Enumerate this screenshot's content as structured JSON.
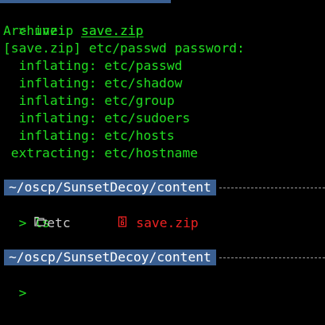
{
  "terminal": {
    "prompt_symbol": ">",
    "unzip_cmd": "unzip",
    "unzip_arg": "save.zip",
    "archive_label": "Archive:  save.zip",
    "password_prompt": "[save.zip] etc/passwd password:",
    "output_lines": [
      "  inflating: etc/passwd",
      "  inflating: etc/shadow",
      "  inflating: etc/group",
      "  inflating: etc/sudoers",
      "  inflating: etc/hosts",
      " extracting: etc/hostname"
    ],
    "cwd": "~/oscp/SunsetDecoy/content",
    "ls_cmd": "ls",
    "ls_items": [
      {
        "name": "etc",
        "icon": "folder-icon",
        "color": "#c8c8c8"
      },
      {
        "name": "save.zip",
        "icon": "archive-file-icon",
        "color": "#ee2222"
      }
    ]
  },
  "colors": {
    "background": "#000000",
    "text_green": "#22dd22",
    "path_bar": "#3a5f91",
    "archive_red": "#ee2222"
  }
}
